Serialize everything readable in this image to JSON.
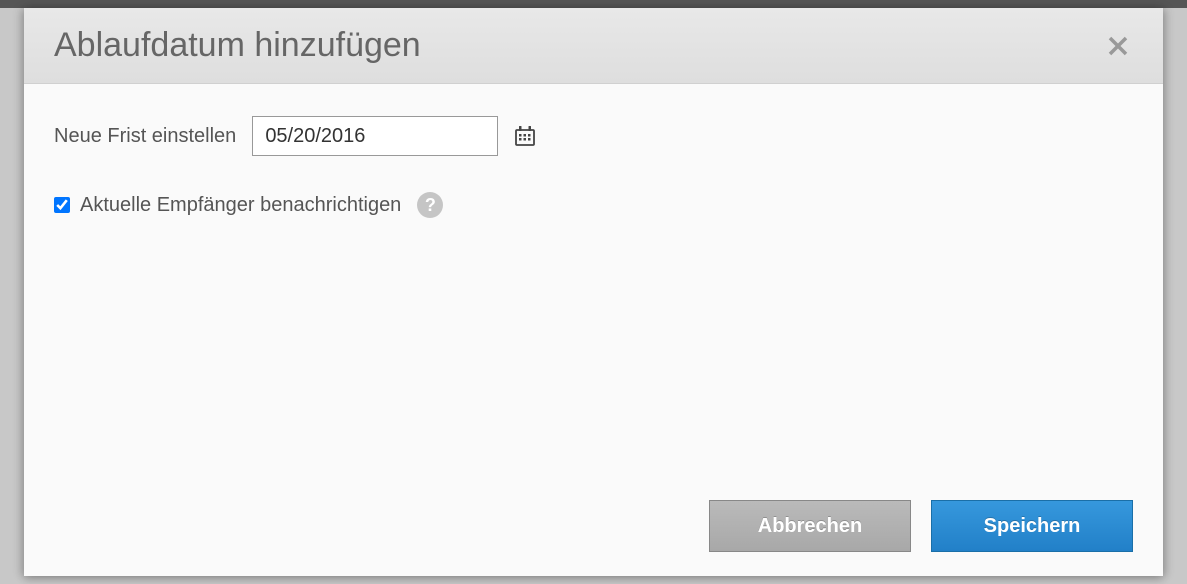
{
  "modal": {
    "title": "Ablaufdatum hinzufügen",
    "date_field": {
      "label": "Neue Frist einstellen",
      "value": "05/20/2016"
    },
    "notify_checkbox": {
      "label": "Aktuelle Empfänger benachrichtigen",
      "checked": true
    },
    "buttons": {
      "cancel": "Abbrechen",
      "save": "Speichern"
    }
  }
}
